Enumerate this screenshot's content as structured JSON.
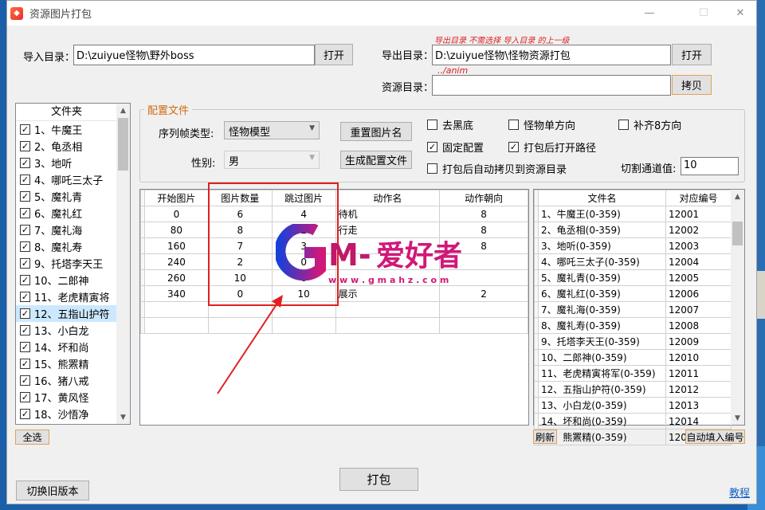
{
  "window": {
    "title": "资源图片打包",
    "minimize": "—",
    "maximize": "☐",
    "close": "✕"
  },
  "export_hint": "导出目录 不需选择 导入目录 的上一级",
  "anim_hint": "../anim",
  "import_dir": {
    "label": "导入目录：",
    "value": "D:\\zuiyue怪物\\野外boss",
    "button": "打开"
  },
  "export_dir": {
    "label": "导出目录：",
    "value": "D:\\zuiyue怪物\\怪物资源打包",
    "button": "打开"
  },
  "res_dir": {
    "label": "资源目录：",
    "value": "",
    "button": "拷贝"
  },
  "folder_list": {
    "header": "文件夹",
    "items": [
      {
        "label": "1、牛魔王",
        "checked": true
      },
      {
        "label": "2、龟丞相",
        "checked": true
      },
      {
        "label": "3、地听",
        "checked": true
      },
      {
        "label": "4、哪吒三太子",
        "checked": true
      },
      {
        "label": "5、魔礼青",
        "checked": true
      },
      {
        "label": "6、魔礼红",
        "checked": true
      },
      {
        "label": "7、魔礼海",
        "checked": true
      },
      {
        "label": "8、魔礼寿",
        "checked": true
      },
      {
        "label": "9、托塔李天王",
        "checked": true
      },
      {
        "label": "10、二郎神",
        "checked": true
      },
      {
        "label": "11、老虎精寅将",
        "checked": true
      },
      {
        "label": "12、五指山护符",
        "checked": true
      },
      {
        "label": "13、小白龙",
        "checked": true
      },
      {
        "label": "14、坏和尚",
        "checked": true
      },
      {
        "label": "15、熊罴精",
        "checked": true
      },
      {
        "label": "16、猪八戒",
        "checked": true
      },
      {
        "label": "17、黄风怪",
        "checked": true
      },
      {
        "label": "18、沙悟净",
        "checked": true
      }
    ],
    "select_all": "全选"
  },
  "config": {
    "group_title": "配置文件",
    "seq_type_label": "序列帧类型:",
    "seq_type_value": "怪物模型",
    "gender_label": "性别:",
    "gender_value": "男",
    "reset_button": "重置图片名",
    "gen_button": "生成配置文件",
    "cut_label": "切割通道值:",
    "cut_value": "10",
    "options": [
      {
        "label": "去黑底",
        "checked": false
      },
      {
        "label": "怪物单方向",
        "checked": false
      },
      {
        "label": "补齐8方向",
        "checked": false
      },
      {
        "label": "固定配置",
        "checked": true
      },
      {
        "label": "打包后打开路径",
        "checked": true
      },
      {
        "label": "打包后自动拷贝到资源目录",
        "checked": false
      }
    ]
  },
  "action_table": {
    "headers": [
      "开始图片",
      "图片数量",
      "跳过图片",
      "动作名",
      "动作朝向"
    ],
    "rows": [
      [
        "0",
        "6",
        "4",
        "待机",
        "8"
      ],
      [
        "80",
        "8",
        "2",
        "行走",
        "8"
      ],
      [
        "160",
        "7",
        "3",
        "",
        "8"
      ],
      [
        "240",
        "2",
        "0",
        "",
        ""
      ],
      [
        "260",
        "10",
        "0",
        "",
        ""
      ],
      [
        "340",
        "0",
        "10",
        "展示",
        "2"
      ]
    ],
    "empty_rows": 2
  },
  "file_table": {
    "headers": [
      "文件名",
      "对应编号"
    ],
    "rows": [
      [
        "1、牛魔王(0-359)",
        "12001"
      ],
      [
        "2、龟丞相(0-359)",
        "12002"
      ],
      [
        "3、地听(0-359)",
        "12003"
      ],
      [
        "4、哪吒三太子(0-359)",
        "12004"
      ],
      [
        "5、魔礼青(0-359)",
        "12005"
      ],
      [
        "6、魔礼红(0-359)",
        "12006"
      ],
      [
        "7、魔礼海(0-359)",
        "12007"
      ],
      [
        "8、魔礼寿(0-359)",
        "12008"
      ],
      [
        "9、托塔李天王(0-359)",
        "12009"
      ],
      [
        "10、二郎神(0-359)",
        "12010"
      ],
      [
        "11、老虎精寅将军(0-359)",
        "12011"
      ],
      [
        "12、五指山护符(0-359)",
        "12012"
      ],
      [
        "13、小白龙(0-359)",
        "12013"
      ],
      [
        "14、坏和尚(0-359)",
        "12014"
      ],
      [
        "15、熊罴精(0-359)",
        "12015"
      ]
    ],
    "refresh": "刷新",
    "auto_fill": "自动填入编号"
  },
  "bottom": {
    "switch_old": "切换旧版本",
    "pack": "打包",
    "tutorial": "教程"
  },
  "watermark": {
    "logo": "GM-爱好者",
    "url": "w w w . g m a h z . c o m"
  },
  "colors": {
    "accent_red": "#e02020",
    "group_title": "#d06a10",
    "selection": "#cce8ff",
    "link": "#1060c0"
  }
}
